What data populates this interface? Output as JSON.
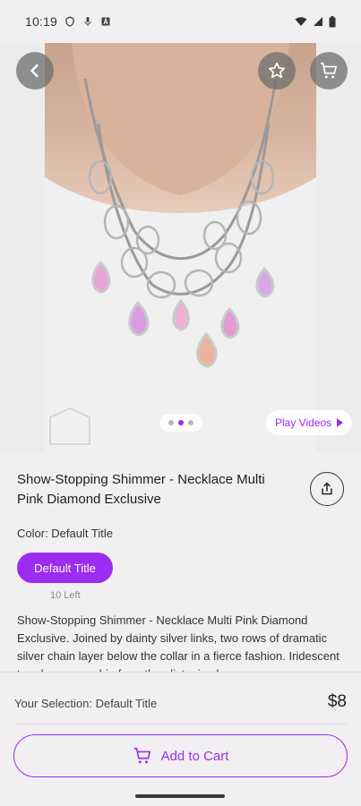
{
  "status_bar": {
    "time": "10:19"
  },
  "hero": {
    "pager": {
      "count": 3,
      "active_index": 1
    },
    "play_videos_label": "Play Videos"
  },
  "product": {
    "title": "Show-Stopping Shimmer - Necklace Multi Pink Diamond Exclusive",
    "color_label": "Color: Default Title",
    "variant_label": "Default Title",
    "stock_text": "10 Left",
    "description": "Show-Stopping Shimmer - Necklace Multi Pink Diamond Exclusive. Joined by dainty silver links, two rows of dramatic silver chain layer below the collar in a fierce fashion. Iridescent teardrop gems drip from the glistening layers."
  },
  "bottom_bar": {
    "selection_label": "Your Selection: Default Title",
    "price": "$8",
    "add_to_cart_label": "Add to Cart"
  },
  "colors": {
    "accent": "#9b2cf0",
    "background": "#f1eff2"
  },
  "icons": {
    "back": "chevron-left-icon",
    "favorite": "star-outline-icon",
    "cart": "cart-icon",
    "share": "share-icon"
  }
}
